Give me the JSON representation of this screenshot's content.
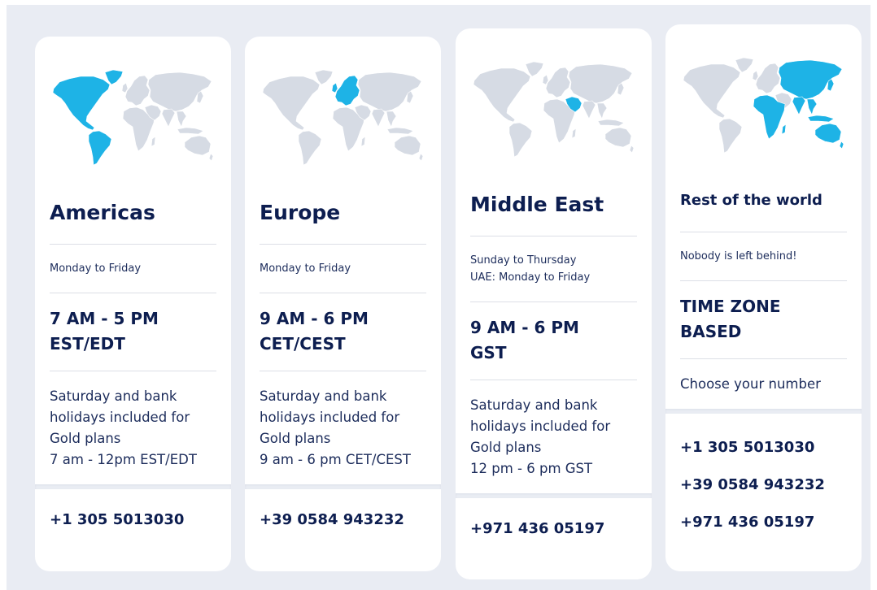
{
  "colors": {
    "page_background": "#e9ecf3",
    "card_background": "#ffffff",
    "heading": "#0d1e50",
    "text": "#1c2c5b",
    "divider": "#dcdfe6",
    "map_base": "#d6dbe4",
    "map_highlight": "#1eb3e6"
  },
  "cards": [
    {
      "map_icon": "americas-map-icon",
      "title": "Americas",
      "days": [
        "Monday to Friday"
      ],
      "hours": [
        "7 AM - 5 PM",
        "EST/EDT"
      ],
      "note": "Saturday and bank holidays included for Gold plans",
      "note_hours": "7 am - 12pm EST/EDT",
      "phones": [
        "+1 305 5013030"
      ]
    },
    {
      "map_icon": "europe-map-icon",
      "title": "Europe",
      "days": [
        "Monday to Friday"
      ],
      "hours": [
        "9 AM - 6 PM",
        "CET/CEST"
      ],
      "note": "Saturday and bank holidays included for Gold plans",
      "note_hours": "9 am - 6 pm CET/CEST",
      "phones": [
        "+39 0584 943232"
      ]
    },
    {
      "map_icon": "middle-east-map-icon",
      "title": "Middle East",
      "days": [
        "Sunday to Thursday",
        "UAE: Monday to Friday"
      ],
      "hours": [
        "9 AM - 6 PM",
        "GST"
      ],
      "note": "Saturday and bank holidays included for Gold plans",
      "note_hours": "12 pm - 6 pm GST",
      "phones": [
        "+971 436 05197"
      ]
    },
    {
      "map_icon": "rest-of-world-map-icon",
      "title": "Rest of the world",
      "days": [
        "Nobody is left behind!"
      ],
      "hours": [
        "TIME ZONE",
        "BASED"
      ],
      "note": "Choose your number",
      "phones": [
        "+1 305 5013030",
        "+39 0584 943232",
        "+971 436 05197"
      ]
    }
  ]
}
